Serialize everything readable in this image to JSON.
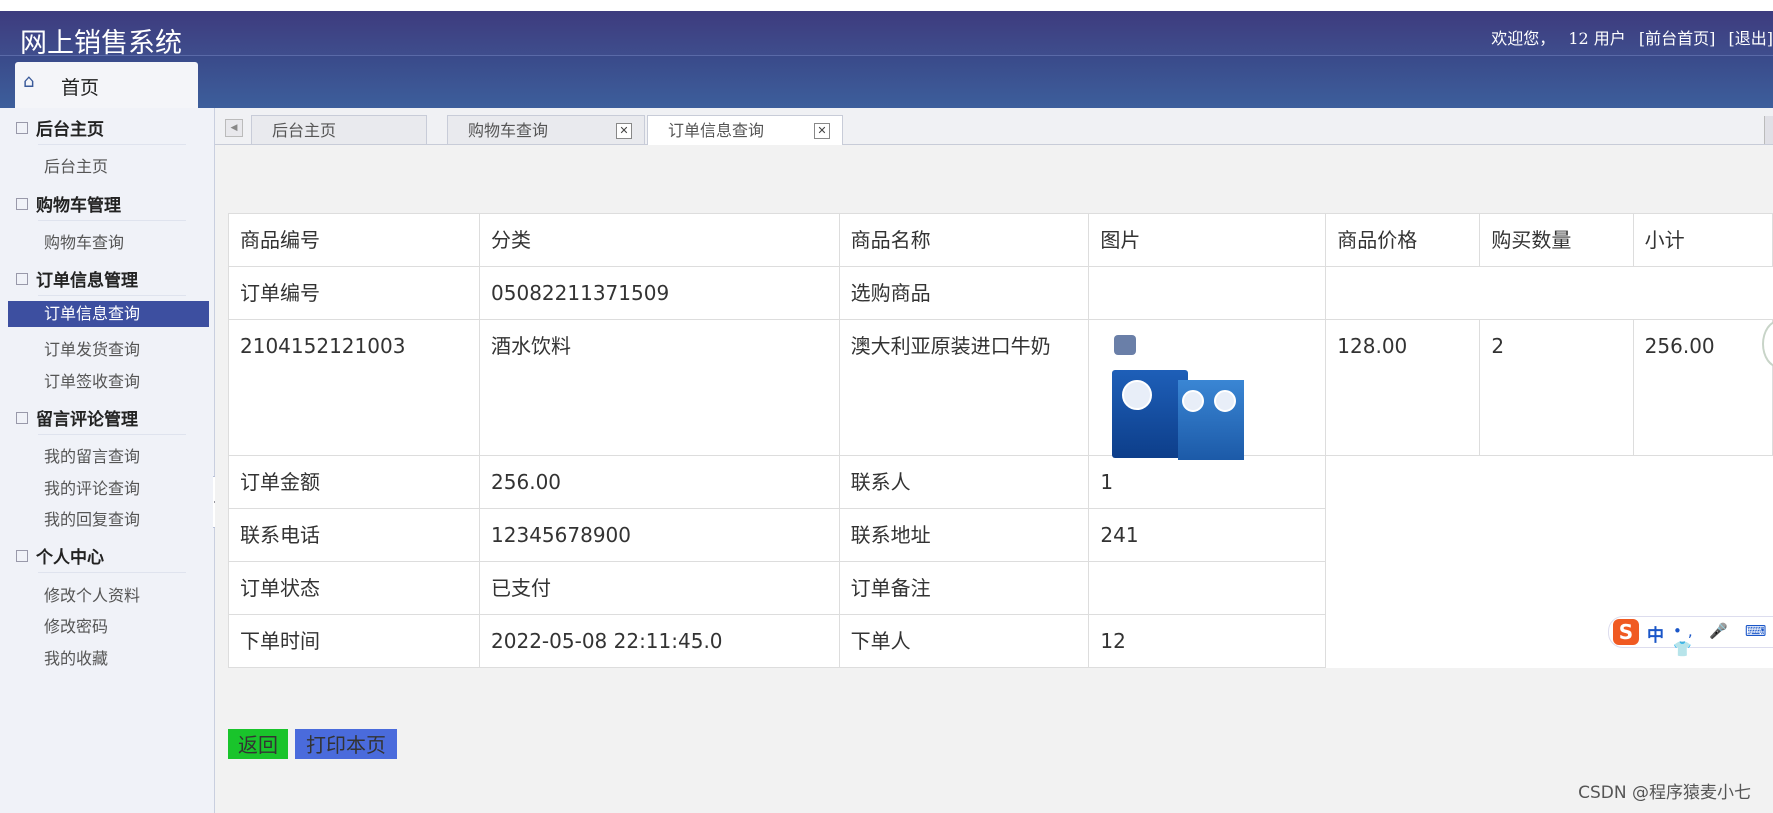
{
  "header": {
    "app_title": "网上销售系统",
    "welcome": "欢迎您，",
    "user": "12 用户",
    "front_link": "[前台首页]",
    "logout_link": "[退出]",
    "home_tab": "首页"
  },
  "sidebar": {
    "groups": [
      {
        "label": "后台主页",
        "items": [
          "后台主页"
        ]
      },
      {
        "label": "购物车管理",
        "items": [
          "购物车查询"
        ]
      },
      {
        "label": "订单信息管理",
        "items": [
          "订单信息查询",
          "订单发货查询",
          "订单签收查询"
        ]
      },
      {
        "label": "留言评论管理",
        "items": [
          "我的留言查询",
          "我的评论查询",
          "我的回复查询"
        ]
      },
      {
        "label": "个人中心",
        "items": [
          "修改个人资料",
          "修改密码",
          "我的收藏"
        ]
      }
    ],
    "active_item": "订单信息查询"
  },
  "tabs": [
    {
      "label": "后台主页"
    },
    {
      "label": "购物车查询",
      "close": "✕"
    },
    {
      "label": "订单信息查询",
      "close": "✕"
    }
  ],
  "table": {
    "header": [
      "商品编号",
      "分类",
      "商品名称",
      "图片",
      "商品价格",
      "购买数量",
      "小计"
    ],
    "order_no_label": "订单编号",
    "order_no": "05082211371509",
    "selected_goods_label": "选购商品",
    "item": {
      "code": "2104152121003",
      "category": "酒水饮料",
      "name": "澳大利亚原装进口牛奶",
      "price": "128.00",
      "qty": "2",
      "subtotal": "256.00"
    },
    "details": [
      {
        "k1": "订单金额",
        "v1": "256.00",
        "k2": "联系人",
        "v2": "1"
      },
      {
        "k1": "联系电话",
        "v1": "12345678900",
        "k2": "联系地址",
        "v2": "241"
      },
      {
        "k1": "订单状态",
        "v1": "已支付",
        "k2": "订单备注",
        "v2": ""
      },
      {
        "k1": "下单时间",
        "v1": "2022-05-08 22:11:45.0",
        "k2": "下单人",
        "v2": "12"
      }
    ]
  },
  "buttons": {
    "back": "返回",
    "print": "打印本页"
  },
  "ime": {
    "logo": "S",
    "mode": "中",
    "tools": "•, 🎤 ⌨ 👕"
  },
  "watermark": "CSDN @程序猿麦小七",
  "colors": {
    "header": "#3d4a8a",
    "active_item": "#3d4fa0",
    "back_btn": "#19c42b",
    "print_btn": "#4a6bdc"
  }
}
